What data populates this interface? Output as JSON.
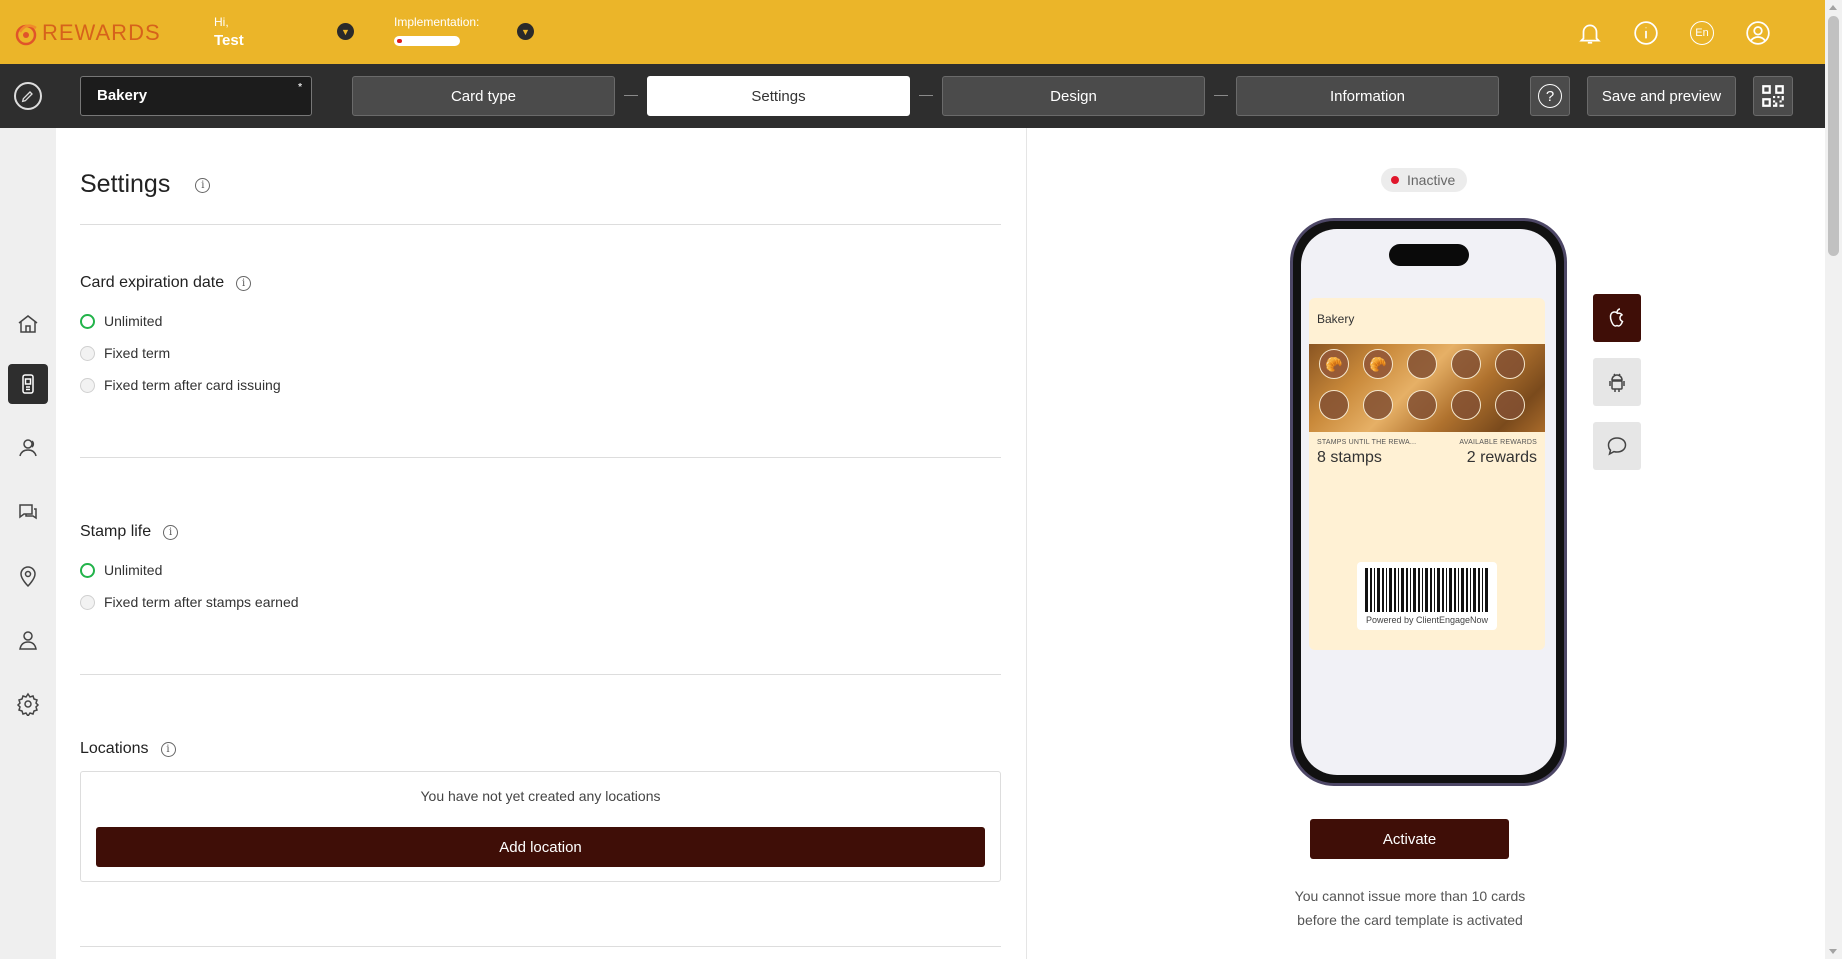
{
  "app": {
    "logo_text": "REWARDS"
  },
  "header": {
    "greeting": "Hi,",
    "user_name": "Test",
    "implementation_label": "Implementation:",
    "implementation_progress": 0.08,
    "language": "En"
  },
  "toolbar": {
    "card_name": "Bakery",
    "steps": [
      "Card type",
      "Settings",
      "Design",
      "Information"
    ],
    "active_step": "Settings",
    "help_symbol": "?",
    "save_label": "Save and preview"
  },
  "sidebar": {
    "items": [
      "home-icon",
      "card-icon",
      "clients-icon",
      "chat-icon",
      "location-icon",
      "user-icon",
      "settings-icon"
    ],
    "active": "card-icon"
  },
  "settings": {
    "title": "Settings",
    "expiration": {
      "title": "Card expiration date",
      "options": [
        "Unlimited",
        "Fixed term",
        "Fixed term after card issuing"
      ],
      "selected": "Unlimited"
    },
    "stamp_life": {
      "title": "Stamp life",
      "options": [
        "Unlimited",
        "Fixed term after stamps earned"
      ],
      "selected": "Unlimited"
    },
    "locations": {
      "title": "Locations",
      "empty_message": "You have not yet created any locations",
      "add_label": "Add location"
    }
  },
  "preview": {
    "status": "Inactive",
    "status_color": "#e0162b",
    "card": {
      "name": "Bakery",
      "stamps_label": "STAMPS UNTIL THE REWA...",
      "stamps_value": "8 stamps",
      "rewards_label": "AVAILABLE REWARDS",
      "rewards_value": "2 rewards",
      "total_stamps": 10,
      "earned_stamps": 2,
      "powered_by": "Powered by ClientEngageNow"
    },
    "platforms": [
      "apple-icon",
      "android-icon",
      "message-icon"
    ],
    "active_platform": "apple-icon",
    "activate_label": "Activate",
    "note": "You cannot issue more than 10 cards before the card template is activated"
  },
  "colors": {
    "brand": "#ebb529",
    "accent": "#3f0e07",
    "radio_on": "#22b34a",
    "toolbar": "#2e2e2e"
  }
}
